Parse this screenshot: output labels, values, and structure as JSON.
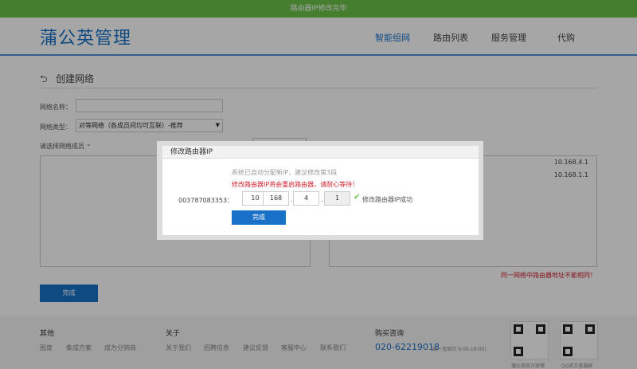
{
  "topbar": {
    "message": "路由器IP修改完毕",
    "color": "#6cc24a"
  },
  "header": {
    "logo": "蒲公英管理",
    "nav": [
      {
        "label": "智能组网",
        "active": true
      },
      {
        "label": "路由列表",
        "active": false
      },
      {
        "label": "服务管理",
        "active": false
      },
      {
        "label": "代购",
        "active": false
      }
    ],
    "accent": "#1a72c8"
  },
  "main": {
    "back_icon": "back-arrow-icon",
    "title": "创建网络",
    "form": {
      "name_label": "网络名称：",
      "name_value": "",
      "type_label": "网络类型：",
      "type_value": "对等网络（各成员间均可互联）-推荐",
      "members_label": "请选择网络成员"
    },
    "right_ips": [
      "10.168.4.1",
      "10.168.1.1"
    ],
    "warning": "同一网络中路由器地址不能相同！",
    "done_label": "完成"
  },
  "modal": {
    "title": "修改路由器IP",
    "hint": "系统已自动分配新IP，建议修改第3段",
    "warning": "修改路由器IP将会重启路由器，请耐心等待！",
    "device_id": "003787083353：",
    "ip": [
      "10",
      "168",
      "4",
      "1"
    ],
    "success": "修改路由器IP成功",
    "button": "完成"
  },
  "footer": {
    "sections": [
      {
        "heading": "其他",
        "links": [
          "图度",
          "集成方案",
          "成为分销商"
        ]
      },
      {
        "heading": "关于",
        "links": [
          "关于我们",
          "招聘信息",
          "建议反馈",
          "客服中心",
          "联系我们"
        ]
      },
      {
        "heading": "购买咨询",
        "links": []
      }
    ],
    "phone": "020-62219018",
    "hours": "(周一至周日 9:00-18:00)",
    "qr": [
      {
        "caption": "蒲公英官方微博"
      },
      {
        "caption": "QQ官方客服群"
      }
    ]
  }
}
